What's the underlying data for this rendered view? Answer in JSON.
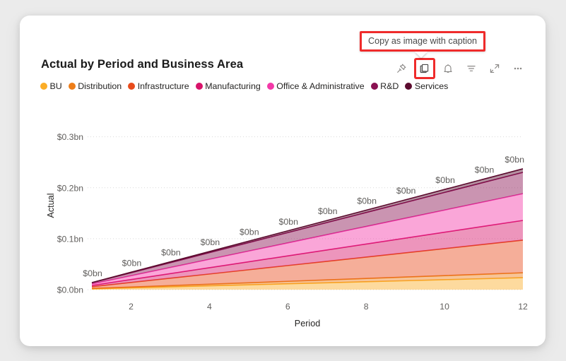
{
  "card": {
    "title": "Actual by Period and Business Area"
  },
  "tooltip": {
    "text": "Copy as image with caption"
  },
  "toolbar": {
    "buttons": [
      {
        "name": "pin-icon",
        "label": "Pin to dashboard",
        "highlighted": false
      },
      {
        "name": "copy-icon",
        "label": "Copy as image with caption",
        "highlighted": true
      },
      {
        "name": "bell-icon",
        "label": "Alerts",
        "highlighted": false
      },
      {
        "name": "filter-icon",
        "label": "Filters",
        "highlighted": false
      },
      {
        "name": "focus-mode-icon",
        "label": "Focus mode",
        "highlighted": false
      },
      {
        "name": "more-options-icon",
        "label": "More options",
        "highlighted": false
      }
    ]
  },
  "legend": [
    {
      "label": "BU",
      "color": "#FBAD27"
    },
    {
      "label": "Distribution",
      "color": "#ED7D18"
    },
    {
      "label": "Infrastructure",
      "color": "#E84B1C"
    },
    {
      "label": "Manufacturing",
      "color": "#D8136A"
    },
    {
      "label": "Office & Administrative",
      "color": "#F339A8"
    },
    {
      "label": "R&D",
      "color": "#8A1152"
    },
    {
      "label": "Services",
      "color": "#5B0B2E"
    }
  ],
  "chart_data": {
    "type": "area",
    "title": "Actual by Period and Business Area",
    "xlabel": "Period",
    "ylabel": "Actual",
    "grid": true,
    "stacked": true,
    "legend_position": "top-left",
    "x": [
      1,
      2,
      3,
      4,
      5,
      6,
      7,
      8,
      9,
      10,
      11,
      12
    ],
    "xticks": [
      2,
      4,
      6,
      8,
      10,
      12
    ],
    "xlim": [
      1,
      12
    ],
    "ylim": [
      0,
      0.33
    ],
    "yticks": [
      0.0,
      0.1,
      0.2,
      0.3
    ],
    "ytick_labels": [
      "$0.0bn",
      "$0.1bn",
      "$0.2bn",
      "$0.3bn"
    ],
    "data_labels": [
      "$0bn",
      "$0bn",
      "$0bn",
      "$0bn",
      "$0bn",
      "$0bn",
      "$0bn",
      "$0bn",
      "$0bn",
      "$0bn",
      "$0bn",
      "$0bn"
    ],
    "series": [
      {
        "name": "BU",
        "color": "#FBAD27",
        "values": [
          0.0015,
          0.0035,
          0.0055,
          0.0075,
          0.0095,
          0.0115,
          0.0135,
          0.0155,
          0.0175,
          0.0195,
          0.0215,
          0.0235
        ]
      },
      {
        "name": "Distribution",
        "color": "#ED7D18",
        "values": [
          0.0008,
          0.0016,
          0.0024,
          0.0032,
          0.004,
          0.0048,
          0.0056,
          0.0064,
          0.0072,
          0.008,
          0.0088,
          0.0096
        ]
      },
      {
        "name": "Infrastructure",
        "color": "#E84B1C",
        "values": [
          0.0035,
          0.009,
          0.0145,
          0.02,
          0.0255,
          0.031,
          0.0365,
          0.042,
          0.0475,
          0.053,
          0.0585,
          0.064
        ]
      },
      {
        "name": "Manufacturing",
        "color": "#D8136A",
        "values": [
          0.0025,
          0.0058,
          0.0091,
          0.0124,
          0.0157,
          0.019,
          0.0223,
          0.0256,
          0.0289,
          0.0322,
          0.0355,
          0.0388
        ]
      },
      {
        "name": "Office & Administrative",
        "color": "#F339A8",
        "values": [
          0.003,
          0.0075,
          0.012,
          0.0165,
          0.021,
          0.0255,
          0.03,
          0.0345,
          0.039,
          0.0435,
          0.048,
          0.0525
        ]
      },
      {
        "name": "R&D",
        "color": "#8A1152",
        "values": [
          0.0022,
          0.0058,
          0.0094,
          0.013,
          0.0166,
          0.0202,
          0.0238,
          0.0274,
          0.031,
          0.0346,
          0.0382,
          0.0418
        ]
      },
      {
        "name": "Services",
        "color": "#5B0B2E",
        "values": [
          0.0004,
          0.001,
          0.0016,
          0.0022,
          0.0028,
          0.0034,
          0.004,
          0.0046,
          0.0052,
          0.0058,
          0.0064,
          0.007
        ]
      }
    ]
  }
}
